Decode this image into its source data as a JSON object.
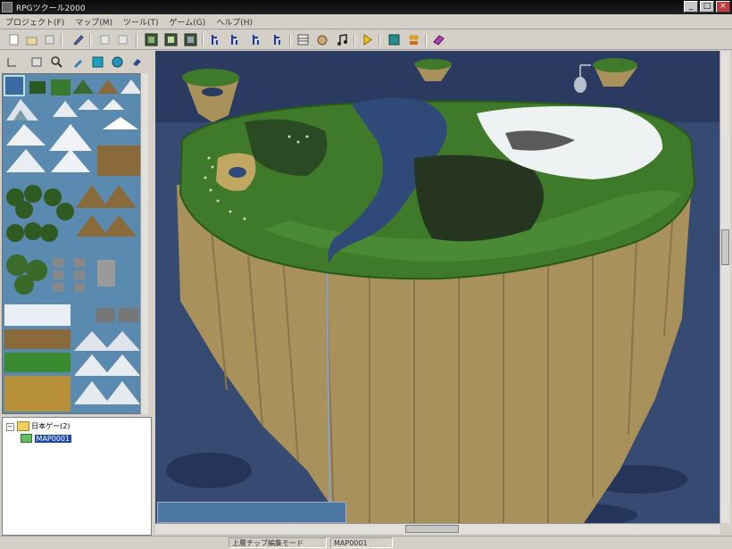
{
  "window": {
    "title": "RPGツクール2000"
  },
  "window_buttons": {
    "minimize": "_",
    "maximize": "□",
    "close": "×"
  },
  "menu": {
    "items": [
      "プロジェクト(F)",
      "マップ(M)",
      "ツール(T)",
      "ゲーム(G)",
      "ヘルプ(H)"
    ]
  },
  "toolbar": {
    "icons": [
      "new-icon",
      "open-icon",
      "close-icon",
      "save-icon",
      "cut-icon",
      "copy-icon",
      "map-layer-icon",
      "event-layer-icon",
      "layer3-icon",
      "zoom-1-icon",
      "zoom-2-icon",
      "zoom-4-icon",
      "zoom-8-icon",
      "database-icon",
      "material-icon",
      "sound-icon",
      "play-icon",
      "fullscreen-icon",
      "title-icon",
      "rpg-icon"
    ]
  },
  "draw_tools": {
    "icons": [
      "pencil-icon",
      "rectangle-icon",
      "ellipse-icon",
      "fill-icon",
      "select-icon",
      "shadow-icon",
      "zoom-icon"
    ]
  },
  "tree": {
    "root_label": "日本ゲー(2)",
    "map_label": "MAP0001"
  },
  "status": {
    "mode": "上層チップ編集モード",
    "map_name": "MAP0001"
  },
  "colors": {
    "water": "#2f4a78",
    "grass": "#3f7a2a",
    "cliff": "#a8915a",
    "snow": "#eef2f2"
  }
}
